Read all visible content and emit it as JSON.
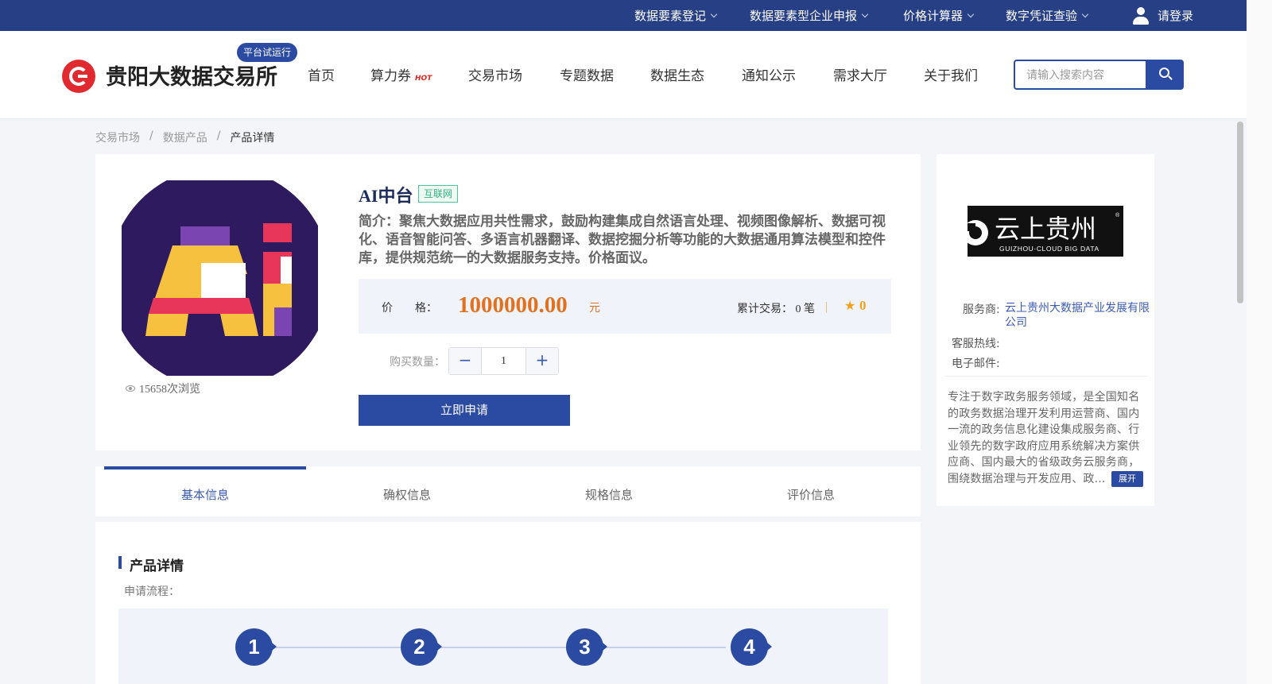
{
  "topbar": {
    "items": [
      {
        "label": "数据要素登记"
      },
      {
        "label": "数据要素型企业申报"
      },
      {
        "label": "价格计算器"
      },
      {
        "label": "数字凭证查验"
      }
    ],
    "login_label": "请登录"
  },
  "header": {
    "logo_text": "贵阳大数据交易所",
    "trial_badge": "平台试运行",
    "nav": [
      {
        "label": "首页"
      },
      {
        "label": "算力券"
      },
      {
        "label": "交易市场"
      },
      {
        "label": "专题数据"
      },
      {
        "label": "数据生态"
      },
      {
        "label": "通知公示"
      },
      {
        "label": "需求大厅"
      },
      {
        "label": "关于我们"
      }
    ],
    "hot_label": "HOT",
    "search_placeholder": "请输入搜索内容"
  },
  "breadcrumb": {
    "items": [
      "交易市场",
      "数据产品",
      "产品详情"
    ],
    "separator": "/"
  },
  "product": {
    "title": "AI中台",
    "tag": "互联网",
    "description": "简介：聚焦大数据应用共性需求，鼓励构建集成自然语言处理、视频图像解析、数据可视化、语音智能问答、多语言机器翻译、数据挖掘分析等功能的大数据通用算法模型和控件库，提供规范统一的大数据服务支持。价格面议。",
    "price_label": "价　　格：",
    "price": "1000000.00",
    "price_unit": "元",
    "trade_label": "累计交易：",
    "trade_count": "0 笔",
    "rating": "0",
    "views": "15658次浏览",
    "qty_label": "购买数量：",
    "qty": "1",
    "qty_minus": "−",
    "qty_plus": "+",
    "apply_label": "立即申请"
  },
  "provider": {
    "logo_text": "云上贵州",
    "logo_sub": "GUIZHOU·CLOUD BIG DATA",
    "provider_label": "服务商:",
    "provider_name": "云上贵州大数据产业发展有限公司",
    "hotline_label": "客服热线:",
    "email_label": "电子邮件:",
    "description": "专注于数字政务服务领域，是全国知名的政务数据治理开发利用运营商、国内一流的政务信息化建设集成服务商、行业领先的数字政府应用系统解决方案供应商、国内最大的省级政务云服务商，围绕数据治理与开发应用、政...",
    "expand_label": "展开"
  },
  "tabs": [
    {
      "label": "基本信息",
      "active": true
    },
    {
      "label": "确权信息"
    },
    {
      "label": "规格信息"
    },
    {
      "label": "评价信息"
    }
  ],
  "details": {
    "title": "产品详情",
    "flow_label": "申请流程：",
    "steps": [
      "1",
      "2",
      "3",
      "4"
    ]
  },
  "colors": {
    "primary": "#2b4aa2",
    "topbar": "#273f85",
    "price": "#e1711f",
    "tag": "#2db37d",
    "logo_red": "#e02a30"
  }
}
